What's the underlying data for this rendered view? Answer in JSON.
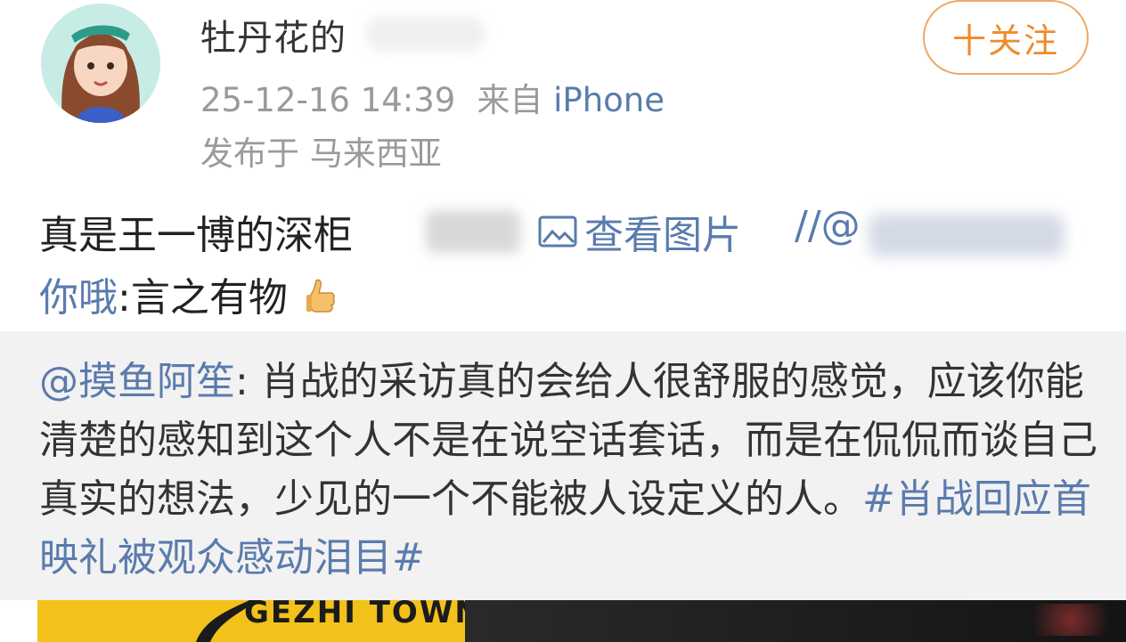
{
  "post": {
    "username": "牡丹花的",
    "follow_label": "十关注",
    "timestamp": "25-12-16 14:39",
    "source_prefix": "来自",
    "device": "iPhone",
    "location": "发布于 马来西亚",
    "text_line1": "真是王一博的深柜",
    "view_image_label": "查看图片",
    "at_link": "//@",
    "mention_suffix": "你哦",
    "text_line2_rest": ":言之有物"
  },
  "repost": {
    "mention": "@摸鱼阿笙",
    "body": ": 肖战的采访真的会给人很舒服的感觉，应该你能清楚的感知到这个人不是在说空话套话，而是在侃侃而谈自己真实的想法，少见的一个不能被人设定义的人。",
    "hashtag": "#肖战回应首映礼被观众感动泪目#"
  },
  "media": {
    "brand_text": "GEZHI TOWN"
  },
  "colors": {
    "link": "#5a7bad",
    "follow": "#f08a2b",
    "meta": "#9a9a9a",
    "repost_bg": "#f2f2f2"
  }
}
